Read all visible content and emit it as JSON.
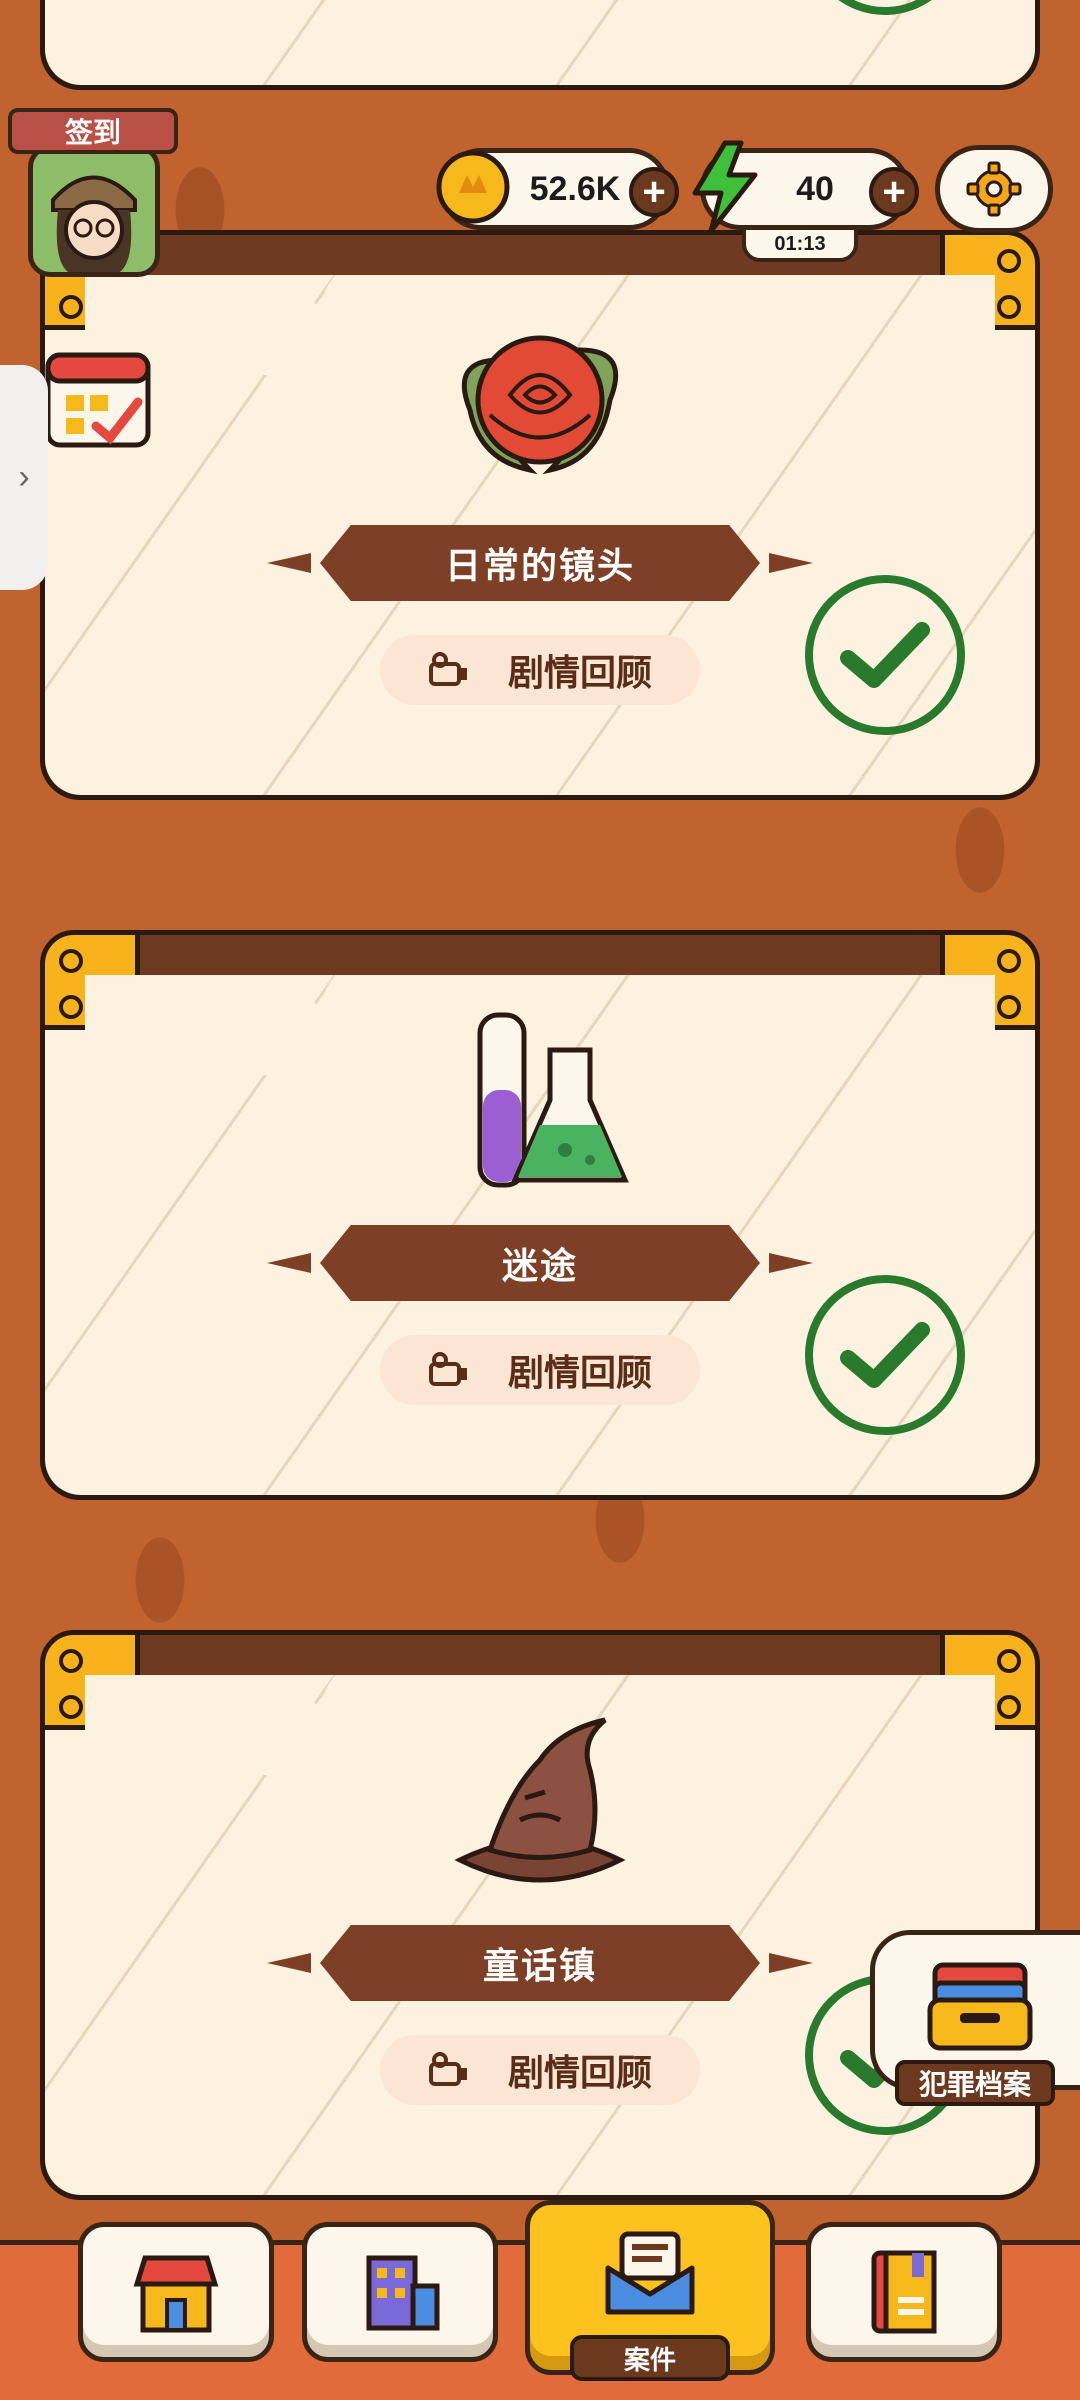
{
  "top_bar": {
    "coins": "52.6K",
    "energy": "40",
    "energy_timer": "01:13"
  },
  "side": {
    "checkin_label": "签到",
    "crime_file_label": "犯罪档案"
  },
  "cases": [
    {
      "title": "日常的镜头",
      "recap_label": "剧情回顾",
      "icon": "rose-icon",
      "completed": true
    },
    {
      "title": "迷途",
      "recap_label": "剧情回顾",
      "icon": "potion-flasks-icon",
      "completed": true
    },
    {
      "title": "童话镇",
      "recap_label": "剧情回顾",
      "icon": "sorting-hat-icon",
      "completed": true
    }
  ],
  "bottom_nav": {
    "items": [
      {
        "icon": "shop-icon"
      },
      {
        "icon": "building-icon"
      },
      {
        "icon": "case-envelope-icon",
        "label": "案件",
        "active": true
      },
      {
        "icon": "book-icon"
      }
    ]
  },
  "colors": {
    "background": "#c0632e",
    "paper": "#fdf1e0",
    "banner": "#7d4026",
    "check_green": "#2a7a2e",
    "accent_yellow": "#fdc21e"
  }
}
